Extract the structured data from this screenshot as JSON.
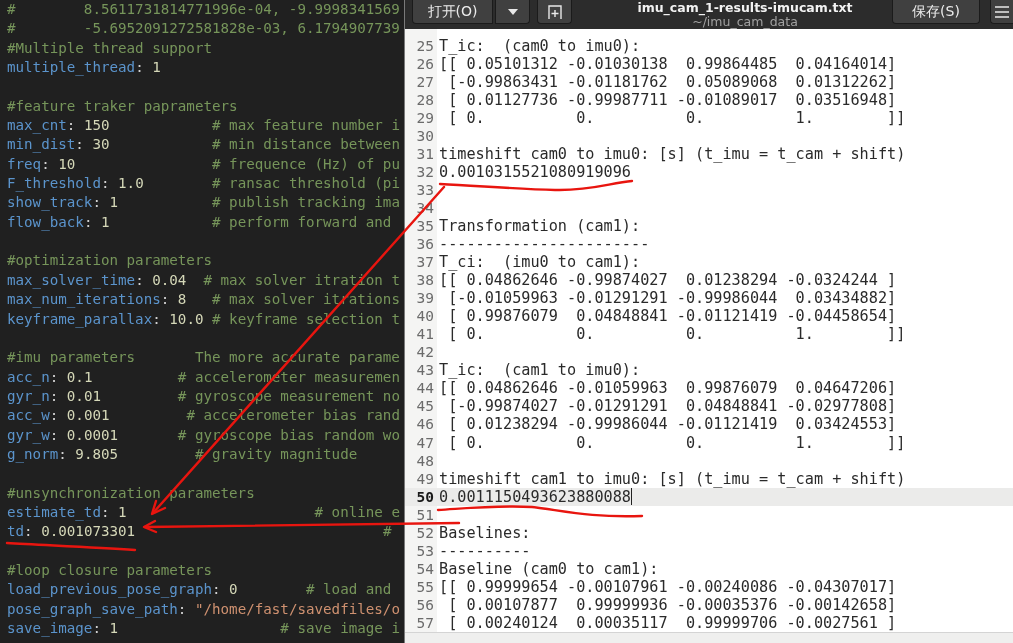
{
  "editor_left": {
    "lines": [
      {
        "kind": "code",
        "tokens": [
          {
            "kind": "comment",
            "text": "#        8.5611731814771996e-04, -9.9998341569"
          }
        ]
      },
      {
        "kind": "code",
        "tokens": [
          {
            "kind": "comment",
            "text": "#        -5.6952091272581828e-03, 6.1794907739"
          }
        ]
      },
      {
        "kind": "code",
        "tokens": [
          {
            "kind": "comment",
            "text": "#Multiple thread support"
          }
        ]
      },
      {
        "kind": "code",
        "tokens": [
          {
            "kind": "key",
            "text": "multiple_thread"
          },
          {
            "kind": "plain",
            "text": ": "
          },
          {
            "kind": "number",
            "text": "1"
          }
        ]
      },
      {
        "kind": "blank"
      },
      {
        "kind": "code",
        "tokens": [
          {
            "kind": "comment",
            "text": "#feature traker paprameters"
          }
        ]
      },
      {
        "kind": "code",
        "tokens": [
          {
            "kind": "key",
            "text": "max_cnt"
          },
          {
            "kind": "plain",
            "text": ": "
          },
          {
            "kind": "number",
            "text": "150"
          },
          {
            "kind": "comment",
            "text": "            # max feature number i"
          }
        ]
      },
      {
        "kind": "code",
        "tokens": [
          {
            "kind": "key",
            "text": "min_dist"
          },
          {
            "kind": "plain",
            "text": ": "
          },
          {
            "kind": "number",
            "text": "30"
          },
          {
            "kind": "comment",
            "text": "            # min distance between"
          }
        ]
      },
      {
        "kind": "code",
        "tokens": [
          {
            "kind": "key",
            "text": "freq"
          },
          {
            "kind": "plain",
            "text": ": "
          },
          {
            "kind": "number",
            "text": "10"
          },
          {
            "kind": "comment",
            "text": "                # frequence (Hz) of pu"
          }
        ]
      },
      {
        "kind": "code",
        "tokens": [
          {
            "kind": "key",
            "text": "F_threshold"
          },
          {
            "kind": "plain",
            "text": ": "
          },
          {
            "kind": "number",
            "text": "1.0"
          },
          {
            "kind": "comment",
            "text": "        # ransac threshold (pi"
          }
        ]
      },
      {
        "kind": "code",
        "tokens": [
          {
            "kind": "key",
            "text": "show_track"
          },
          {
            "kind": "plain",
            "text": ": "
          },
          {
            "kind": "number",
            "text": "1"
          },
          {
            "kind": "comment",
            "text": "           # publish tracking ima"
          }
        ]
      },
      {
        "kind": "code",
        "tokens": [
          {
            "kind": "key",
            "text": "flow_back"
          },
          {
            "kind": "plain",
            "text": ": "
          },
          {
            "kind": "number",
            "text": "1"
          },
          {
            "kind": "comment",
            "text": "            # perform forward and"
          }
        ]
      },
      {
        "kind": "blank"
      },
      {
        "kind": "code",
        "tokens": [
          {
            "kind": "comment",
            "text": "#optimization parameters"
          }
        ]
      },
      {
        "kind": "code",
        "tokens": [
          {
            "kind": "key",
            "text": "max_solver_time"
          },
          {
            "kind": "plain",
            "text": ": "
          },
          {
            "kind": "number",
            "text": "0.04"
          },
          {
            "kind": "comment",
            "text": "  # max solver itration t"
          }
        ]
      },
      {
        "kind": "code",
        "tokens": [
          {
            "kind": "key",
            "text": "max_num_iterations"
          },
          {
            "kind": "plain",
            "text": ": "
          },
          {
            "kind": "number",
            "text": "8"
          },
          {
            "kind": "comment",
            "text": "   # max solver itrations"
          }
        ]
      },
      {
        "kind": "code",
        "tokens": [
          {
            "kind": "key",
            "text": "keyframe_parallax"
          },
          {
            "kind": "plain",
            "text": ": "
          },
          {
            "kind": "number",
            "text": "10.0"
          },
          {
            "kind": "comment",
            "text": " # keyframe selection t"
          }
        ]
      },
      {
        "kind": "blank"
      },
      {
        "kind": "code",
        "tokens": [
          {
            "kind": "comment",
            "text": "#imu parameters       The more accurate parame"
          }
        ]
      },
      {
        "kind": "code",
        "tokens": [
          {
            "kind": "key",
            "text": "acc_n"
          },
          {
            "kind": "plain",
            "text": ": "
          },
          {
            "kind": "number",
            "text": "0.1"
          },
          {
            "kind": "comment",
            "text": "          # accelerometer measuremen"
          }
        ]
      },
      {
        "kind": "code",
        "tokens": [
          {
            "kind": "key",
            "text": "gyr_n"
          },
          {
            "kind": "plain",
            "text": ": "
          },
          {
            "kind": "number",
            "text": "0.01"
          },
          {
            "kind": "comment",
            "text": "         # gyroscope measurement no"
          }
        ]
      },
      {
        "kind": "code",
        "tokens": [
          {
            "kind": "key",
            "text": "acc_w"
          },
          {
            "kind": "plain",
            "text": ": "
          },
          {
            "kind": "number",
            "text": "0.001"
          },
          {
            "kind": "comment",
            "text": "         # accelerometer bias rand"
          }
        ]
      },
      {
        "kind": "code",
        "tokens": [
          {
            "kind": "key",
            "text": "gyr_w"
          },
          {
            "kind": "plain",
            "text": ": "
          },
          {
            "kind": "number",
            "text": "0.0001"
          },
          {
            "kind": "comment",
            "text": "       # gyroscope bias random wo"
          }
        ]
      },
      {
        "kind": "code",
        "tokens": [
          {
            "kind": "key",
            "text": "g_norm"
          },
          {
            "kind": "plain",
            "text": ": "
          },
          {
            "kind": "number",
            "text": "9.805"
          },
          {
            "kind": "comment",
            "text": "         # gravity magnitude"
          }
        ]
      },
      {
        "kind": "blank"
      },
      {
        "kind": "code",
        "tokens": [
          {
            "kind": "comment",
            "text": "#unsynchronization parameters"
          }
        ]
      },
      {
        "kind": "code",
        "tokens": [
          {
            "kind": "key",
            "text": "estimate_td"
          },
          {
            "kind": "plain",
            "text": ": "
          },
          {
            "kind": "number",
            "text": "1"
          },
          {
            "kind": "comment",
            "text": "                      # online e"
          }
        ]
      },
      {
        "kind": "code",
        "tokens": [
          {
            "kind": "key",
            "text": "td"
          },
          {
            "kind": "plain",
            "text": ": "
          },
          {
            "kind": "number",
            "text": "0.001073301"
          },
          {
            "kind": "comment",
            "text": "                             #"
          }
        ]
      },
      {
        "kind": "blank"
      },
      {
        "kind": "code",
        "tokens": [
          {
            "kind": "comment",
            "text": "#loop closure parameters"
          }
        ]
      },
      {
        "kind": "code",
        "tokens": [
          {
            "kind": "key",
            "text": "load_previous_pose_graph"
          },
          {
            "kind": "plain",
            "text": ": "
          },
          {
            "kind": "number",
            "text": "0"
          },
          {
            "kind": "comment",
            "text": "        # load and"
          }
        ]
      },
      {
        "kind": "code",
        "tokens": [
          {
            "kind": "key",
            "text": "pose_graph_save_path"
          },
          {
            "kind": "plain",
            "text": ": "
          },
          {
            "kind": "string",
            "text": "\"/home/fast/savedfiles/o"
          }
        ]
      },
      {
        "kind": "code",
        "tokens": [
          {
            "kind": "key",
            "text": "save_image"
          },
          {
            "kind": "plain",
            "text": ": "
          },
          {
            "kind": "number",
            "text": "1"
          },
          {
            "kind": "comment",
            "text": "                   # save image i"
          }
        ]
      }
    ]
  },
  "header": {
    "open_button": "打开(O)",
    "title": "imu_cam_1-results-imucam.txt",
    "subtitle": "~/imu_cam_data",
    "save_button": "保存(S)"
  },
  "editor_right": {
    "lines": [
      {
        "number": "25",
        "text": "T_ic:  (cam0 to imu0):",
        "current": false
      },
      {
        "number": "26",
        "text": "[[ 0.05101312 -0.01030138  0.99864485  0.04164014]",
        "current": false
      },
      {
        "number": "27",
        "text": " [-0.99863431 -0.01181762  0.05089068  0.01312262]",
        "current": false
      },
      {
        "number": "28",
        "text": " [ 0.01127736 -0.99987711 -0.01089017  0.03516948]",
        "current": false
      },
      {
        "number": "29",
        "text": " [ 0.          0.          0.          1.        ]]",
        "current": false
      },
      {
        "number": "30",
        "current": false
      },
      {
        "number": "31",
        "text": "timeshift cam0 to imu0: [s] (t_imu = t_cam + shift)",
        "current": false
      },
      {
        "number": "32",
        "text": "0.0010315521080919096",
        "current": false
      },
      {
        "number": "33",
        "current": false
      },
      {
        "number": "34",
        "current": false
      },
      {
        "number": "35",
        "text": "Transformation (cam1):",
        "current": false
      },
      {
        "number": "36",
        "text": "-----------------------",
        "current": false
      },
      {
        "number": "37",
        "text": "T_ci:  (imu0 to cam1):",
        "current": false
      },
      {
        "number": "38",
        "text": "[[ 0.04862646 -0.99874027  0.01238294 -0.0324244 ]",
        "current": false
      },
      {
        "number": "39",
        "text": " [-0.01059963 -0.01291291 -0.99986044  0.03434882]",
        "current": false
      },
      {
        "number": "40",
        "text": " [ 0.99876079  0.04848841 -0.01121419 -0.04458654]",
        "current": false
      },
      {
        "number": "41",
        "text": " [ 0.          0.          0.          1.        ]]",
        "current": false
      },
      {
        "number": "42",
        "current": false
      },
      {
        "number": "43",
        "text": "T_ic:  (cam1 to imu0):",
        "current": false
      },
      {
        "number": "44",
        "text": "[[ 0.04862646 -0.01059963  0.99876079  0.04647206]",
        "current": false
      },
      {
        "number": "45",
        "text": " [-0.99874027 -0.01291291  0.04848841 -0.02977808]",
        "current": false
      },
      {
        "number": "46",
        "text": " [ 0.01238294 -0.99986044 -0.01121419  0.03424553]",
        "current": false
      },
      {
        "number": "47",
        "text": " [ 0.          0.          0.          1.        ]]",
        "current": false
      },
      {
        "number": "48",
        "current": false
      },
      {
        "number": "49",
        "text": "timeshift cam1 to imu0: [s] (t_imu = t_cam + shift)",
        "current": false
      },
      {
        "number": "50",
        "text": "0.0011150493623880088",
        "current": true
      },
      {
        "number": "51",
        "current": false
      },
      {
        "number": "52",
        "text": "Baselines:",
        "current": false
      },
      {
        "number": "53",
        "text": "----------",
        "current": false
      },
      {
        "number": "54",
        "text": "Baseline (cam0 to cam1):",
        "current": false
      },
      {
        "number": "55",
        "text": "[[ 0.99999654 -0.00107961 -0.00240086 -0.04307017]",
        "current": false
      },
      {
        "number": "56",
        "text": " [ 0.00107877  0.99999936 -0.00035376 -0.00142658]",
        "current": false
      },
      {
        "number": "57",
        "text": " [ 0.00240124  0.00035117  0.99999706 -0.0027561 ]",
        "current": false
      }
    ]
  }
}
